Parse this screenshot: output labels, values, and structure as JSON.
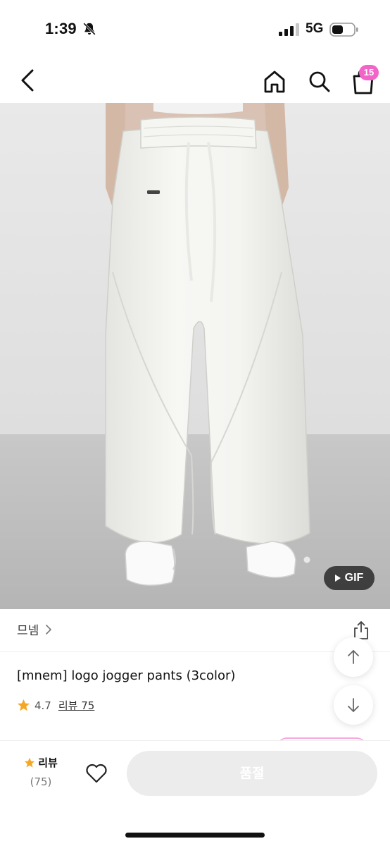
{
  "status_bar": {
    "time": "1:39",
    "network": "5G",
    "icons": [
      "bell-slash-icon",
      "signal-icon",
      "battery-icon"
    ]
  },
  "nav": {
    "icons": [
      "chevron-left-icon",
      "home-icon",
      "search-icon",
      "shopping-bag-icon"
    ],
    "cart_count": "15",
    "badge_color": "#f264c8"
  },
  "product": {
    "gif_label": "GIF",
    "brand": "므넴",
    "title": "[mnem] logo jogger pants (3color)",
    "rating": "4.7",
    "review_link": "리뷰 75"
  },
  "bottom_bar": {
    "review_label": "리뷰",
    "review_count": "(75)",
    "soldout_label": "품절",
    "soldout_bg": "#ececec"
  },
  "colors": {
    "star": "#f5a623",
    "accent_pink": "#f264c8"
  }
}
